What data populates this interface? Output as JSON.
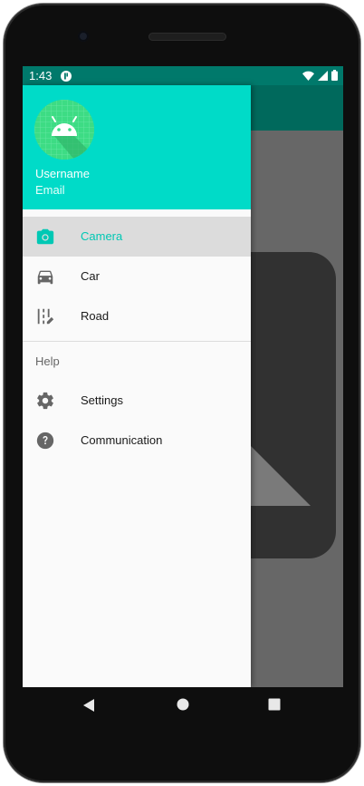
{
  "status_bar": {
    "time": "1:43"
  },
  "drawer": {
    "header": {
      "username": "Username",
      "email": "Email"
    },
    "items": [
      {
        "label": "Camera",
        "icon": "camera-icon",
        "selected": true
      },
      {
        "label": "Car",
        "icon": "car-icon",
        "selected": false
      },
      {
        "label": "Road",
        "icon": "road-icon",
        "selected": false
      }
    ],
    "section_title": "Help",
    "help_items": [
      {
        "label": "Settings",
        "icon": "gear-icon"
      },
      {
        "label": "Communication",
        "icon": "help-icon"
      }
    ]
  },
  "colors": {
    "header": "#00dbc8",
    "accent": "#00c8b4",
    "toolbar": "#00695c",
    "status_bar": "#00796b"
  }
}
